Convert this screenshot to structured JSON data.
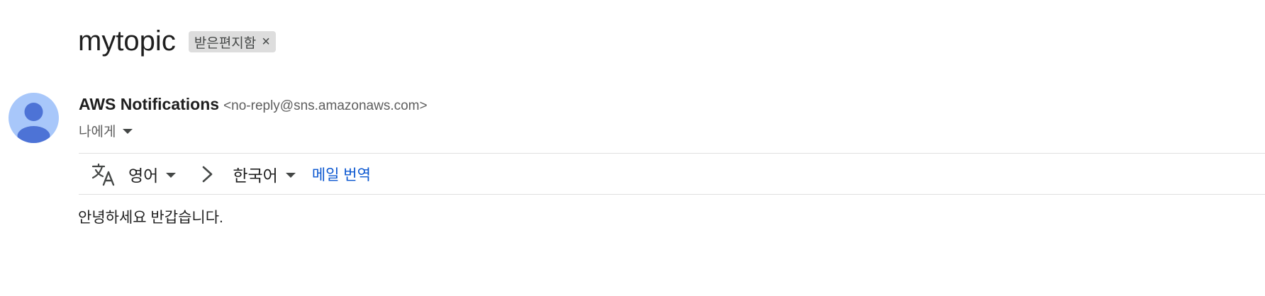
{
  "email": {
    "subject": "mytopic",
    "label": "받은편지함",
    "label_close": "×",
    "sender": {
      "name": "AWS Notifications",
      "email": "<no-reply@sns.amazonaws.com>"
    },
    "recipient": "나에게",
    "translation": {
      "source_language": "영어",
      "target_language": "한국어",
      "translate_link": "메일 번역"
    },
    "body": "안녕하세요 반갑습니다."
  },
  "icons": {
    "avatar": "person-avatar-icon",
    "translate": "translate-icon",
    "arrow": "chevron-right-icon",
    "dropdown": "caret-down-icon"
  },
  "colors": {
    "link": "#0b57d0",
    "avatar_bg": "#a8c7fa",
    "avatar_fg": "#4d73d6",
    "chip_bg": "#dddddd"
  }
}
